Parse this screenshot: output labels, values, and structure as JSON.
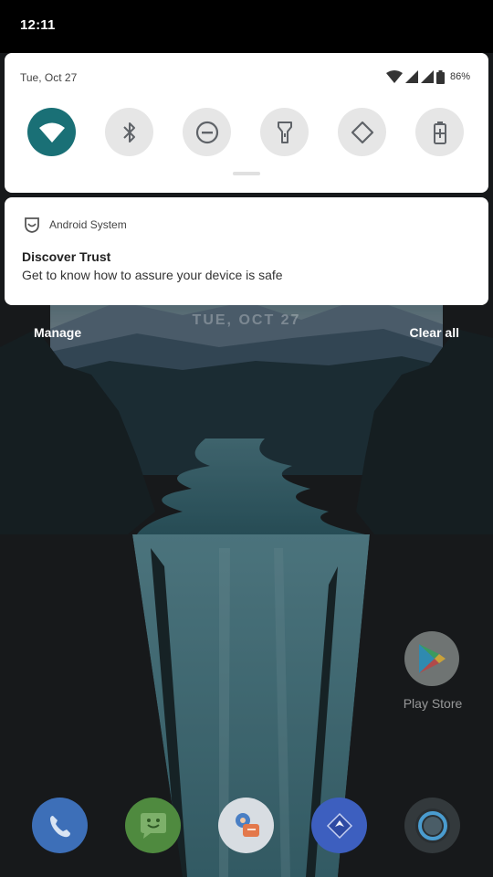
{
  "status_bar": {
    "time": "12:11"
  },
  "quick_settings": {
    "date": "Tue, Oct 27",
    "battery_percent": "86%",
    "tiles": [
      {
        "name": "wifi",
        "icon": "wifi-icon",
        "active": true
      },
      {
        "name": "bluetooth",
        "icon": "bluetooth-icon",
        "active": false
      },
      {
        "name": "do-not-disturb",
        "icon": "do-not-disturb-icon",
        "active": false
      },
      {
        "name": "flashlight",
        "icon": "flashlight-icon",
        "active": false
      },
      {
        "name": "auto-rotate",
        "icon": "auto-rotate-icon",
        "active": false
      },
      {
        "name": "battery-saver",
        "icon": "battery-saver-icon",
        "active": false
      }
    ],
    "accent_color": "#1a7076"
  },
  "notification": {
    "app_name": "Android System",
    "title": "Discover Trust",
    "text": "Get to know how to assure your device is safe"
  },
  "shade_actions": {
    "manage": "Manage",
    "clear_all": "Clear all"
  },
  "wallpaper": {
    "date_text": "TUE, OCT 27"
  },
  "home_apps": [
    {
      "label": "Play Store",
      "icon": "play-store-icon"
    }
  ],
  "dock": [
    {
      "name": "phone",
      "icon": "phone-icon",
      "color": "#3d6fb8"
    },
    {
      "name": "messages",
      "icon": "messages-icon",
      "color": "#4f8a3f"
    },
    {
      "name": "contacts",
      "icon": "contacts-icon",
      "color": "#d8dde2"
    },
    {
      "name": "maps",
      "icon": "maps-icon",
      "color": "#3d5fbf"
    },
    {
      "name": "camera",
      "icon": "camera-icon",
      "color": "#33393c"
    }
  ]
}
